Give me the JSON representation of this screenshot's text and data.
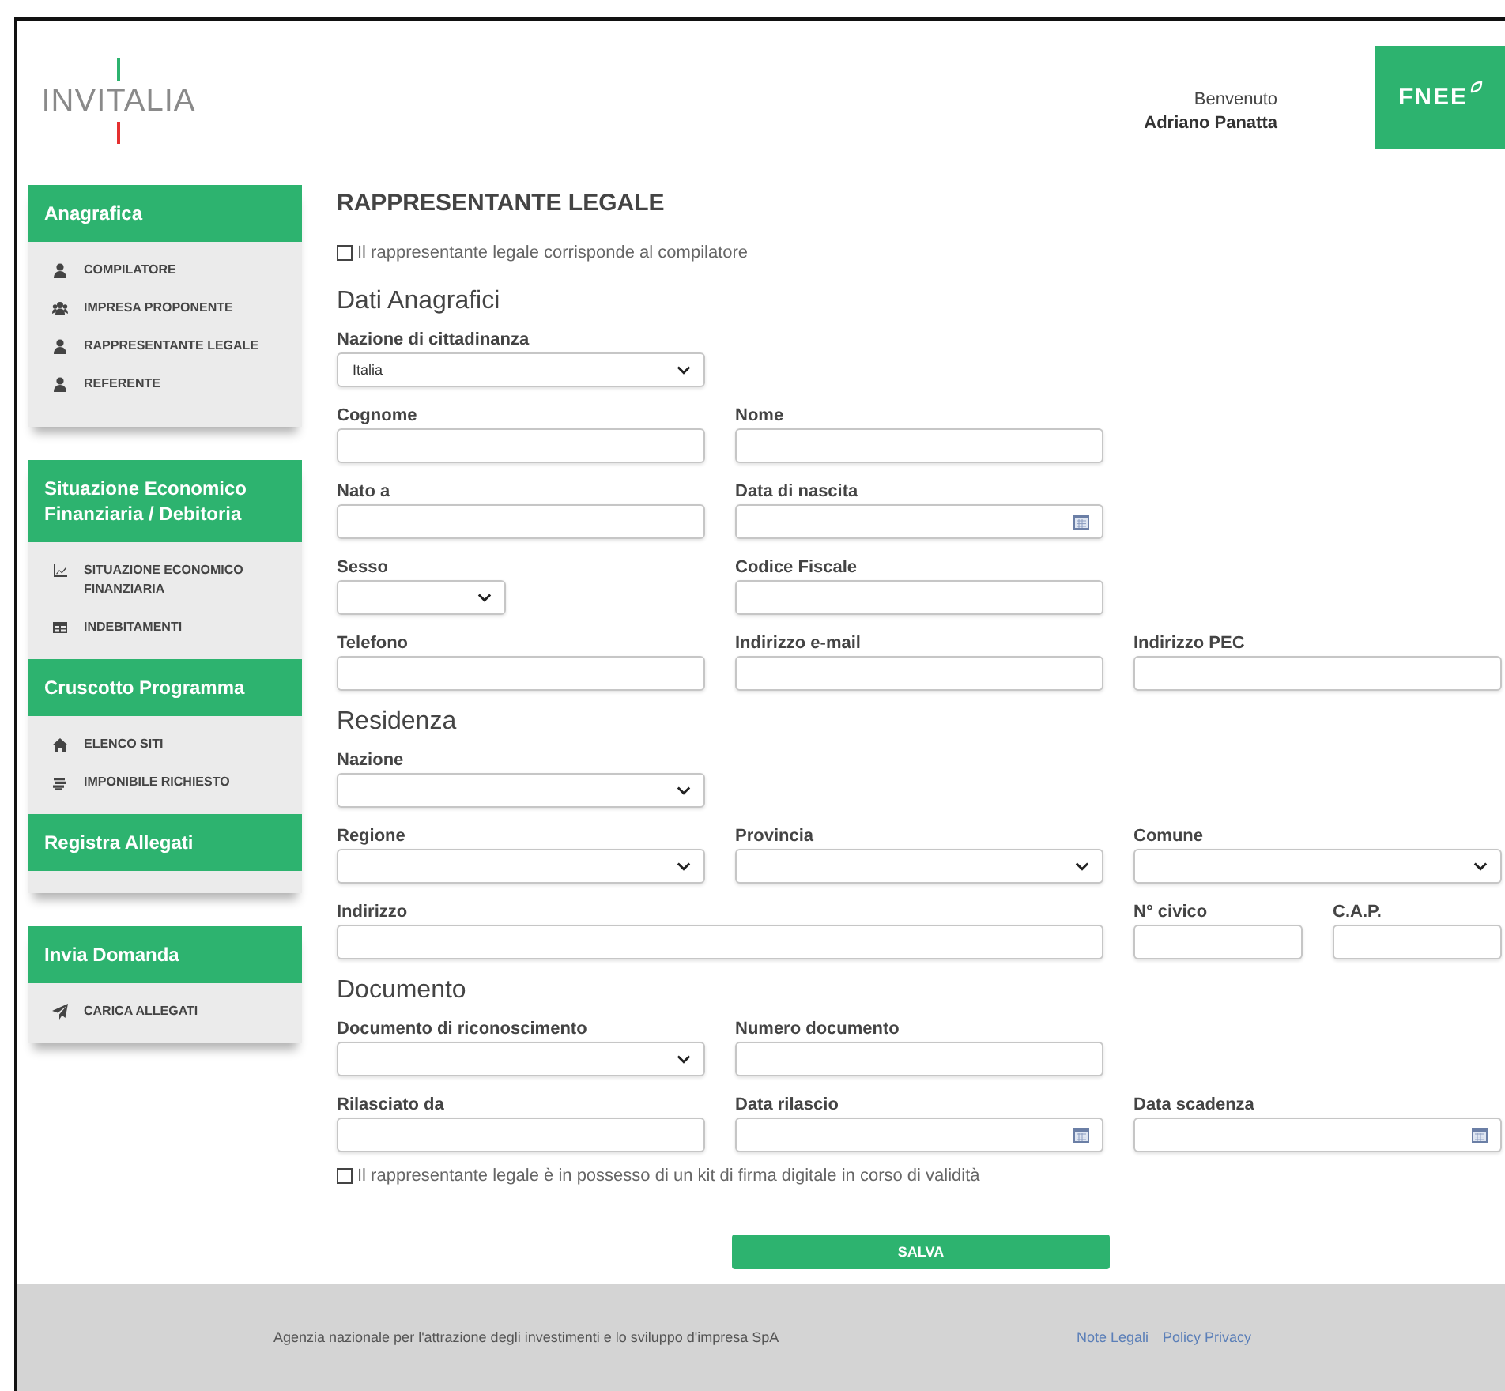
{
  "header": {
    "logo": "INVITALIA",
    "welcome": "Benvenuto",
    "user": "Adriano Panatta",
    "brand_logo": "FNEE"
  },
  "sidebar": {
    "cards": [
      {
        "sections": [
          {
            "title": "Anagrafica",
            "items": [
              {
                "label": "COMPILATORE",
                "kind": "person"
              },
              {
                "label": "IMPRESA PROPONENTE",
                "kind": "group"
              },
              {
                "label": "RAPPRESENTANTE LEGALE",
                "kind": "person"
              },
              {
                "label": "REFERENTE",
                "kind": "person"
              }
            ]
          }
        ]
      },
      {
        "sections": [
          {
            "title": "Situazione Economico Finanziaria / Debitoria",
            "items": [
              {
                "label": "SITUAZIONE ECONOMICO FINANZIARIA",
                "kind": "chart"
              },
              {
                "label": "INDEBITAMENTI",
                "kind": "table"
              }
            ]
          },
          {
            "title": "Cruscotto Programma",
            "items": [
              {
                "label": "ELENCO SITI",
                "kind": "home"
              },
              {
                "label": "IMPONIBILE RICHIESTO",
                "kind": "coins"
              }
            ]
          },
          {
            "title": "Registra Allegati"
          }
        ]
      },
      {
        "sections": [
          {
            "title": "Invia Domanda",
            "items": [
              {
                "label": "CARICA ALLEGATI",
                "kind": "send"
              }
            ]
          }
        ]
      }
    ]
  },
  "form": {
    "title": "RAPPRESENTANTE LEGALE",
    "top_checkbox": {
      "label": "Il rappresentante legale corrisponde al compilatore",
      "checked": false
    },
    "sections": [
      {
        "heading": "Dati Anagrafici",
        "rows": [
          {
            "fields": [
              {
                "label": "Nazione di cittadinanza",
                "kind": "select",
                "value": "Italia"
              }
            ]
          },
          {
            "fields": [
              {
                "label": "Cognome",
                "kind": "text"
              },
              {
                "label": "Nome",
                "kind": "text"
              }
            ]
          },
          {
            "fields": [
              {
                "label": "Nato a",
                "kind": "text"
              },
              {
                "label": "Data di nascita",
                "kind": "date"
              }
            ]
          },
          {
            "fields": [
              {
                "label": "Sesso",
                "kind": "narrow_select"
              },
              {
                "label": "Codice Fiscale",
                "kind": "text"
              }
            ]
          },
          {
            "fields": [
              {
                "label": "Telefono",
                "kind": "text"
              },
              {
                "label": "Indirizzo e-mail",
                "kind": "text"
              },
              {
                "label": "Indirizzo PEC",
                "kind": "text"
              }
            ]
          }
        ]
      },
      {
        "heading": "Residenza",
        "rows": [
          {
            "fields": [
              {
                "label": "Nazione",
                "kind": "select"
              }
            ]
          },
          {
            "fields": [
              {
                "label": "Regione",
                "kind": "select"
              },
              {
                "label": "Provincia",
                "kind": "select"
              },
              {
                "label": "Comune",
                "kind": "select"
              }
            ]
          },
          {
            "fields": [
              {
                "label": "Indirizzo",
                "kind": "wide_text"
              },
              {
                "label": "N° civico",
                "kind": "short_text"
              },
              {
                "label": "C.A.P.",
                "kind": "short_text"
              }
            ]
          }
        ]
      },
      {
        "heading": "Documento",
        "rows": [
          {
            "fields": [
              {
                "label": "Documento di riconoscimento",
                "kind": "select"
              },
              {
                "label": "Numero documento",
                "kind": "text"
              }
            ]
          },
          {
            "fields": [
              {
                "label": "Rilasciato da",
                "kind": "text"
              },
              {
                "label": "Data rilascio",
                "kind": "date"
              },
              {
                "label": "Data scadenza",
                "kind": "date"
              }
            ]
          }
        ]
      }
    ],
    "bottom_checkbox": {
      "label": "Il rappresentante legale è in possesso di un kit di firma digitale in corso di validità",
      "checked": false
    },
    "save_button": "SALVA"
  },
  "footer": {
    "text": "Agenzia nazionale per l'attrazione degli investimenti e lo sviluppo d'impresa SpA",
    "links": [
      "Note Legali",
      "Policy Privacy"
    ]
  }
}
